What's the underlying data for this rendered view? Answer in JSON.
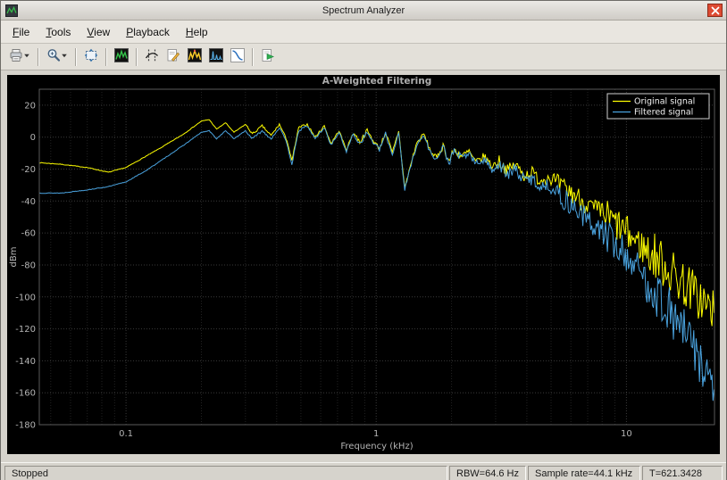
{
  "window": {
    "title": "Spectrum Analyzer"
  },
  "menu": {
    "items": [
      {
        "label": "File"
      },
      {
        "label": "Tools"
      },
      {
        "label": "View"
      },
      {
        "label": "Playback"
      },
      {
        "label": "Help"
      }
    ]
  },
  "toolbar": {
    "buttons": [
      {
        "name": "print",
        "icon": "printer-icon",
        "dropdown": true
      },
      {
        "sep": true
      },
      {
        "name": "zoom",
        "icon": "magnifier-icon",
        "dropdown": true
      },
      {
        "sep": true
      },
      {
        "name": "scale-axes",
        "icon": "fit-view-icon"
      },
      {
        "sep": true
      },
      {
        "name": "spectrum-settings",
        "icon": "spectrum-settings-icon"
      },
      {
        "sep": true
      },
      {
        "name": "cursor-measurements",
        "icon": "cursor-measurements-icon"
      },
      {
        "name": "signal-statistics",
        "icon": "signal-statistics-icon"
      },
      {
        "name": "peak-finder",
        "icon": "peak-finder-icon"
      },
      {
        "name": "distortion-measurements",
        "icon": "distortion-measurements-icon"
      },
      {
        "name": "ccdf-measurements",
        "icon": "ccdf-measurements-icon"
      },
      {
        "sep": true
      },
      {
        "name": "playback-run",
        "icon": "playback-run-icon"
      }
    ]
  },
  "status": {
    "state": "Stopped",
    "rbw": "RBW=64.6 Hz",
    "sample_rate": "Sample rate=44.1 kHz",
    "time": "T=621.3428"
  },
  "chart_data": {
    "type": "line",
    "title": "A-Weighted Filtering",
    "xlabel": "Frequency (kHz)",
    "ylabel": "dBm",
    "xscale": "log",
    "xlim": [
      0.045,
      22.5
    ],
    "ylim": [
      -180,
      30
    ],
    "yticks": [
      20,
      0,
      -20,
      -40,
      -60,
      -80,
      -100,
      -120,
      -140,
      -160,
      -180
    ],
    "xticks": [
      {
        "v": 0.1,
        "label": "0.1"
      },
      {
        "v": 1,
        "label": "1"
      },
      {
        "v": 10,
        "label": "10"
      }
    ],
    "grid": true,
    "legend": {
      "position": "top-right",
      "entries": [
        "Original signal",
        "Filtered signal"
      ]
    },
    "colors": {
      "plot_bg": "#000000",
      "grid": "#3a3a3a",
      "grid_minor": "#222222",
      "tick_text": "#b4b4b4",
      "title_text": "#aeaeae"
    },
    "noise_profile": [
      [
        0.3,
        0.2
      ],
      [
        0.8,
        0.7
      ],
      [
        1.8,
        1.4
      ],
      [
        3,
        2.5
      ],
      [
        5,
        4
      ],
      [
        8,
        7
      ],
      [
        12,
        11
      ],
      [
        100,
        15
      ]
    ],
    "series": [
      {
        "name": "Original signal",
        "color": "#ffff00",
        "seed": 7,
        "points": [
          [
            0.045,
            -16
          ],
          [
            0.055,
            -17
          ],
          [
            0.07,
            -19
          ],
          [
            0.085,
            -22
          ],
          [
            0.1,
            -19
          ],
          [
            0.12,
            -12
          ],
          [
            0.14,
            -6
          ],
          [
            0.17,
            2
          ],
          [
            0.2,
            10
          ],
          [
            0.215,
            11
          ],
          [
            0.23,
            5
          ],
          [
            0.25,
            9
          ],
          [
            0.27,
            3
          ],
          [
            0.3,
            8
          ],
          [
            0.32,
            2
          ],
          [
            0.35,
            7
          ],
          [
            0.38,
            1
          ],
          [
            0.41,
            8
          ],
          [
            0.44,
            -2
          ],
          [
            0.46,
            -15
          ],
          [
            0.49,
            6
          ],
          [
            0.53,
            8
          ],
          [
            0.57,
            0
          ],
          [
            0.62,
            7
          ],
          [
            0.66,
            -4
          ],
          [
            0.71,
            4
          ],
          [
            0.76,
            -8
          ],
          [
            0.81,
            3
          ],
          [
            0.86,
            -3
          ],
          [
            0.92,
            4
          ],
          [
            0.97,
            -2
          ],
          [
            1.03,
            -7
          ],
          [
            1.09,
            3
          ],
          [
            1.16,
            -10
          ],
          [
            1.23,
            4
          ],
          [
            1.3,
            -32
          ],
          [
            1.38,
            -16
          ],
          [
            1.45,
            -4
          ],
          [
            1.55,
            2
          ],
          [
            1.65,
            -9
          ],
          [
            1.75,
            -13
          ],
          [
            1.85,
            -5
          ],
          [
            1.95,
            -15
          ],
          [
            2.05,
            -8
          ],
          [
            2.2,
            -12
          ],
          [
            2.35,
            -9
          ],
          [
            2.5,
            -16
          ],
          [
            2.7,
            -12
          ],
          [
            2.9,
            -18
          ],
          [
            3.1,
            -15
          ],
          [
            3.35,
            -21
          ],
          [
            3.6,
            -17
          ],
          [
            3.9,
            -24
          ],
          [
            4.2,
            -22
          ],
          [
            4.5,
            -27
          ],
          [
            4.9,
            -25
          ],
          [
            5.3,
            -30
          ],
          [
            5.7,
            -33
          ],
          [
            6.2,
            -36
          ],
          [
            6.7,
            -40
          ],
          [
            7.2,
            -44
          ],
          [
            7.8,
            -47
          ],
          [
            8.4,
            -50
          ],
          [
            9,
            -54
          ],
          [
            9.7,
            -58
          ],
          [
            10.5,
            -63
          ],
          [
            11.3,
            -67
          ],
          [
            12.2,
            -72
          ],
          [
            13.1,
            -75
          ],
          [
            14,
            -79
          ],
          [
            15,
            -84
          ],
          [
            16,
            -88
          ],
          [
            17,
            -92
          ],
          [
            18,
            -95
          ],
          [
            19,
            -99
          ],
          [
            20,
            -102
          ],
          [
            21,
            -106
          ],
          [
            22.4,
            -110
          ]
        ]
      },
      {
        "name": "Filtered signal",
        "color": "#4aa3df",
        "seed": 13,
        "points": [
          [
            0.045,
            -35
          ],
          [
            0.055,
            -35
          ],
          [
            0.07,
            -33
          ],
          [
            0.085,
            -31
          ],
          [
            0.1,
            -28
          ],
          [
            0.12,
            -21
          ],
          [
            0.14,
            -14
          ],
          [
            0.17,
            -5
          ],
          [
            0.2,
            3
          ],
          [
            0.215,
            4
          ],
          [
            0.23,
            -1
          ],
          [
            0.25,
            4
          ],
          [
            0.27,
            -1
          ],
          [
            0.3,
            4
          ],
          [
            0.32,
            -1
          ],
          [
            0.35,
            4
          ],
          [
            0.38,
            -1
          ],
          [
            0.41,
            6
          ],
          [
            0.44,
            -4
          ],
          [
            0.46,
            -17
          ],
          [
            0.49,
            4
          ],
          [
            0.53,
            7
          ],
          [
            0.57,
            -1
          ],
          [
            0.62,
            6
          ],
          [
            0.66,
            -5
          ],
          [
            0.71,
            3
          ],
          [
            0.76,
            -9
          ],
          [
            0.81,
            2
          ],
          [
            0.86,
            -4
          ],
          [
            0.92,
            3
          ],
          [
            0.97,
            -3
          ],
          [
            1.03,
            -8
          ],
          [
            1.09,
            2
          ],
          [
            1.16,
            -11
          ],
          [
            1.23,
            3
          ],
          [
            1.3,
            -33
          ],
          [
            1.38,
            -17
          ],
          [
            1.45,
            -5
          ],
          [
            1.55,
            1
          ],
          [
            1.65,
            -10
          ],
          [
            1.75,
            -14
          ],
          [
            1.85,
            -6
          ],
          [
            1.95,
            -16
          ],
          [
            2.05,
            -9
          ],
          [
            2.2,
            -13
          ],
          [
            2.35,
            -10
          ],
          [
            2.5,
            -17
          ],
          [
            2.7,
            -14
          ],
          [
            2.9,
            -20
          ],
          [
            3.1,
            -17
          ],
          [
            3.35,
            -24
          ],
          [
            3.6,
            -20
          ],
          [
            3.9,
            -27
          ],
          [
            4.2,
            -26
          ],
          [
            4.5,
            -31
          ],
          [
            4.9,
            -30
          ],
          [
            5.3,
            -36
          ],
          [
            5.7,
            -40
          ],
          [
            6.2,
            -44
          ],
          [
            6.7,
            -49
          ],
          [
            7.2,
            -54
          ],
          [
            7.8,
            -58
          ],
          [
            8.4,
            -62
          ],
          [
            9,
            -67
          ],
          [
            9.7,
            -72
          ],
          [
            10.5,
            -78
          ],
          [
            11.3,
            -84
          ],
          [
            12.2,
            -91
          ],
          [
            13.1,
            -97
          ],
          [
            14,
            -103
          ],
          [
            15,
            -110
          ],
          [
            16,
            -116
          ],
          [
            17,
            -122
          ],
          [
            18,
            -128
          ],
          [
            19,
            -135
          ],
          [
            20,
            -142
          ],
          [
            21,
            -149
          ],
          [
            22.4,
            -158
          ]
        ]
      }
    ]
  }
}
